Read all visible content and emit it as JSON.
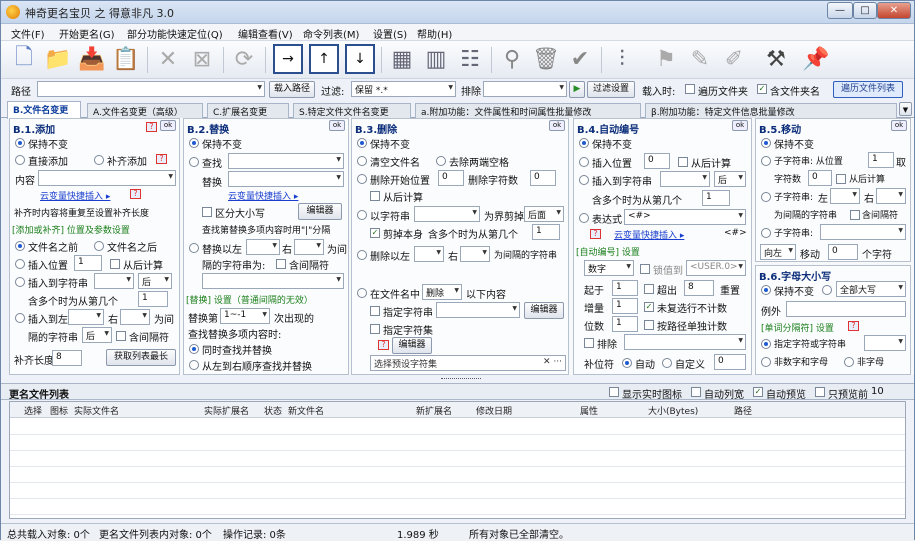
{
  "window": {
    "title": "神奇更名宝贝 之 得意非凡 3.0",
    "min": "—",
    "max": "□",
    "close": "✕"
  },
  "menu": [
    "文件(F)",
    "开始更名(G)",
    "部分功能快速定位(Q)",
    "编辑查看(V)",
    "命令列表(M)",
    "设置(S)",
    "帮助(H)"
  ],
  "pathbar": {
    "path_label": "路径",
    "path_value": "",
    "load_path": "载入路径",
    "filter_label": "过滤:",
    "filter_value": "保留 *.*",
    "exclude_label": "排除",
    "exclude_value": "",
    "filter_settings": "过滤设置",
    "load_label": "载入时:",
    "opt_traverse": "遍历文件夹",
    "opt_include_folder": "含文件夹名",
    "traverse_list": "遍历文件列表"
  },
  "tabs": [
    "B.文件名变更",
    "A.文件名变更（高级）",
    "C.扩展名变更",
    "S.特定文件文件名变更",
    "a.附加功能：文件属性和时间属性批量修改",
    "β.附加功能：特定文件信息批量修改"
  ],
  "p1": {
    "title": "B.1.添加",
    "ok": "ok",
    "keep": "保持不变",
    "direct_add": "直接添加",
    "complement": "补齐添加",
    "content_label": "内容",
    "var_link": "云变量快捷插入 ▸",
    "note": "补齐时内容将重复至设置补齐长度",
    "sect": "[添加或补齐] 位置及参数设置",
    "before": "文件名之前",
    "after": "文件名之后",
    "insert_pos": "插入位置",
    "pos_val": "1",
    "from_back": "从后计算",
    "insert_to_char": "插入到字符串",
    "back": "后",
    "n_times": "含多个时为从第几个",
    "n_val": "1",
    "insert_left": "插入到左",
    "right": "右",
    "for": "为间",
    "sep_label": "隔的字符串",
    "sep_back": "后",
    "merge_sep": "含间隔符",
    "pad_label": "补齐长度",
    "pad_val": "8",
    "get_max": "获取列表最长"
  },
  "p2": {
    "title": "B.2.替换",
    "ok": "ok",
    "keep": "保持不变",
    "find": "查找",
    "replace": "替换",
    "var_link": "云变量快捷插入 ▸",
    "case": "区分大小写",
    "editor": "编辑器",
    "note1": "查找第替换多项内容时用\"|\"分隔",
    "repl_left": "替换以左",
    "right": "右",
    "for": "为间",
    "sep_as": "隔的字符串为:",
    "merge_sep": "含间隔符",
    "sect": "[替换] 设置（普通间隔的无效）",
    "repl_n": "替换第",
    "n_val": "1~-1",
    "n_tail": "次出现的",
    "multi": "查找替换多项内容时:",
    "opt_sync": "同时查找并替换",
    "opt_lr": "从左到右顺序查找并替换"
  },
  "p3": {
    "title": "B.3.删除",
    "ok": "ok",
    "keep": "保持不变",
    "clear": "清空文件名",
    "trim": "去除两端空格",
    "del_start": "删除开始位置",
    "start_val": "0",
    "del_count": "删除字符数",
    "count_val": "0",
    "from_back": "从后计算",
    "by_str": "以字符串",
    "as_bound": "为界剪掉",
    "cut_after": "后面",
    "cut_self": "剪掉本身",
    "multi_n": "含多个时为从第几个",
    "n_val": "1",
    "del_left": "删除以左",
    "right": "右",
    "for_sep": "为间隔的字符串",
    "in_name": "在文件名中",
    "del": "删除",
    "content": "以下内容",
    "spec_str": "指定字符串",
    "editor": "编辑器",
    "spec_set": "指定字符集",
    "editor2": "编辑器",
    "preset": "选择预设字符集"
  },
  "p4": {
    "title": "B.4.自动编号",
    "ok": "ok",
    "keep": "保持不变",
    "insert_pos": "插入位置",
    "pos_val": "0",
    "from_back": "从后计算",
    "insert_to": "插入到字符串",
    "back": "后",
    "n_times": "含多个时为从第几个",
    "n_val": "1",
    "expr": "表达式",
    "expr_val": "<#>",
    "var_link": "云变量快捷插入 ▸",
    "var_tail": "<#>",
    "sect": "[自动编号] 设置",
    "type": "数字",
    "fixed": "锁值到",
    "fixed_val": "<USER.0>",
    "start": "起于",
    "start_val": "1",
    "overflow": "超出",
    "ov_val": "8",
    "reset": "重置",
    "step": "增量",
    "step_val": "1",
    "skip": "未复选行不计数",
    "digits": "位数",
    "dig_val": "1",
    "by_group": "按路径单独计数",
    "exclude": "排除",
    "pad": "补位符",
    "auto": "自动",
    "custom": "自定义",
    "custom_val": "0"
  },
  "p5": {
    "title": "B.5.移动",
    "ok": "ok",
    "keep": "保持不变",
    "substr": "子字符串: 从位置",
    "sub_val": "1",
    "take": "取",
    "sub_count": "字符数",
    "cnt_val": "0",
    "from_back": "从后计算",
    "left": "左",
    "right": "右",
    "for_sep": "为间隔的字符串",
    "merge_sep": "含间隔符",
    "sub2": "子字符串:",
    "dir": "向左",
    "move": "移动",
    "move_val": "0",
    "chars": "个字符"
  },
  "p6": {
    "title": "B.6.字母大小写",
    "keep": "保持不变",
    "all_upper": "全部大写",
    "except": "例外",
    "sect": "[单词分隔符] 设置",
    "spec": "指定字符或字符串",
    "digit_letter": "非数字和字母",
    "non_letter": "非字母"
  },
  "list": {
    "title": "更名文件列表",
    "show_icons": "显示实时图标",
    "auto_width": "自动列宽",
    "auto_preview": "自动预览",
    "max_preview": "只预览前",
    "max_val": "10",
    "columns": [
      "选择",
      "图标",
      "实际文件名",
      "实际扩展名",
      "状态",
      "新文件名",
      "新扩展名",
      "修改日期",
      "属性",
      "大小(Bytes)",
      "路径"
    ]
  },
  "status": {
    "loaded": "总共载入对象: 0个",
    "renamed": "更名文件列表内对象: 0个",
    "ops": "操作记录: 0条",
    "time": "1.989 秒",
    "msg": "所有对象已全部清空。"
  }
}
